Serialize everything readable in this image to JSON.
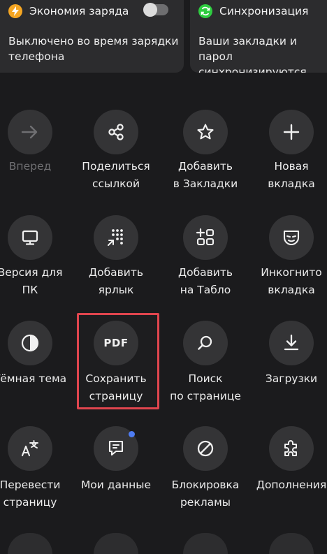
{
  "cards": {
    "battery": {
      "title": "Экономия заряда",
      "desc": "Выключено во время зарядки\nтелефона",
      "toggle_on": false,
      "icon": "lightning-icon",
      "color": "#f5a623"
    },
    "sync": {
      "title": "Синхронизация",
      "desc": "Ваши закладки и парол\nсинхронизируются",
      "icon": "sync-icon",
      "color": "#2ecc40"
    }
  },
  "menu": {
    "forward": {
      "label": "Вперед",
      "disabled": true,
      "icon": "arrow-right-icon"
    },
    "share": {
      "label": "Поделиться\nссылкой",
      "icon": "share-icon"
    },
    "bookmark": {
      "label": "Добавить\nв Закладки",
      "icon": "star-icon"
    },
    "new_tab": {
      "label": "Новая\nвкладка",
      "icon": "plus-icon"
    },
    "desktop": {
      "label": "Версия для\nПК",
      "icon": "monitor-icon"
    },
    "shortcut": {
      "label": "Добавить\nярлык",
      "icon": "shortcut-grid-icon"
    },
    "tablo": {
      "label": "Добавить\nна Табло",
      "icon": "tablo-grid-icon"
    },
    "incognito": {
      "label": "Инкогнито\nвкладка",
      "icon": "mask-icon"
    },
    "dark_theme": {
      "label": "Тёмная тема",
      "icon": "half-circle-icon"
    },
    "save_pdf": {
      "label": "Сохранить\nстраницу",
      "icon_text": "PDF",
      "icon": "pdf-icon"
    },
    "find": {
      "label": "Поиск\nпо странице",
      "icon": "search-icon"
    },
    "downloads": {
      "label": "Загрузки",
      "icon": "download-icon"
    },
    "translate": {
      "label": "Перевести\nстраницу",
      "icon": "translate-icon"
    },
    "my_data": {
      "label": "Мои данные",
      "icon": "my-data-icon",
      "badge_color": "#4e7cf2"
    },
    "adblock": {
      "label": "Блокировка\nрекламы",
      "icon": "block-icon"
    },
    "extensions": {
      "label": "Дополнения",
      "icon": "puzzle-icon"
    }
  },
  "highlight_color": "#e0454e"
}
